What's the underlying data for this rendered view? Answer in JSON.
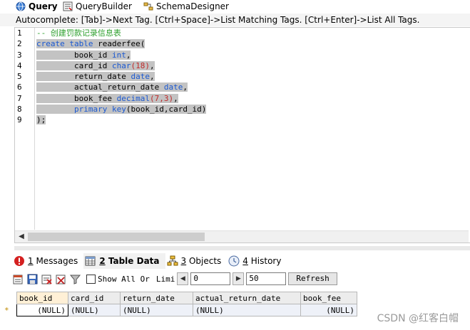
{
  "top_tabs": [
    {
      "label": "Query",
      "icon": "globe-icon",
      "active": true
    },
    {
      "label": "QueryBuilder",
      "icon": "query-builder-icon",
      "active": false
    },
    {
      "label": "SchemaDesigner",
      "icon": "schema-designer-icon",
      "active": false
    }
  ],
  "autocomplete_hint": "Autocomplete: [Tab]->Next Tag. [Ctrl+Space]->List Matching Tags. [Ctrl+Enter]->List All Tags.",
  "editor": {
    "line_numbers": [
      "1",
      "2",
      "3",
      "4",
      "5",
      "6",
      "7",
      "8",
      "9"
    ],
    "lines": {
      "l1": "-- 创建罚款记录信息表",
      "l2_kw1": "create",
      "l2_kw2": "table",
      "l2_name": "readerfee(",
      "l3_name": "book_id",
      "l3_type": "int",
      "l4_name": "card_id",
      "l4_type": "char",
      "l4_num": "(18)",
      "l5_name": "return_date",
      "l5_type": "date",
      "l6_name": "actual_return_date",
      "l6_type": "date",
      "l7_name": "book_fee",
      "l7_type": "decimal",
      "l7_num": "(7,3)",
      "l8_kw": "primary key",
      "l8_rest": "(book_id,card_id)",
      "l9": ");"
    },
    "colors": {
      "keyword": "#1a58d1",
      "comment": "#2ea02e",
      "number": "#c02b2b",
      "selection": "#c3c3c3"
    }
  },
  "result_tabs": [
    {
      "num": "1",
      "label": " Messages",
      "icon": "error-icon",
      "active": false
    },
    {
      "num": "2",
      "label": " Table Data",
      "icon": "table-data-icon",
      "active": true
    },
    {
      "num": "3",
      "label": " Objects",
      "icon": "objects-icon",
      "active": false
    },
    {
      "num": "4",
      "label": " History",
      "icon": "history-icon",
      "active": false
    }
  ],
  "toolbar": {
    "show_all_label": "Show All Or",
    "limit_label": "Limi",
    "offset_value": "0",
    "limit_value": "50",
    "refresh_label": "Refresh"
  },
  "grid": {
    "columns": [
      "book_id",
      "card_id",
      "return_date",
      "actual_return_date",
      "book_fee"
    ],
    "row_marker": "*",
    "row": [
      "(NULL)",
      "(NULL)",
      "(NULL)",
      "(NULL)",
      "(NULL)"
    ]
  },
  "watermark": "CSDN @红客白帽"
}
